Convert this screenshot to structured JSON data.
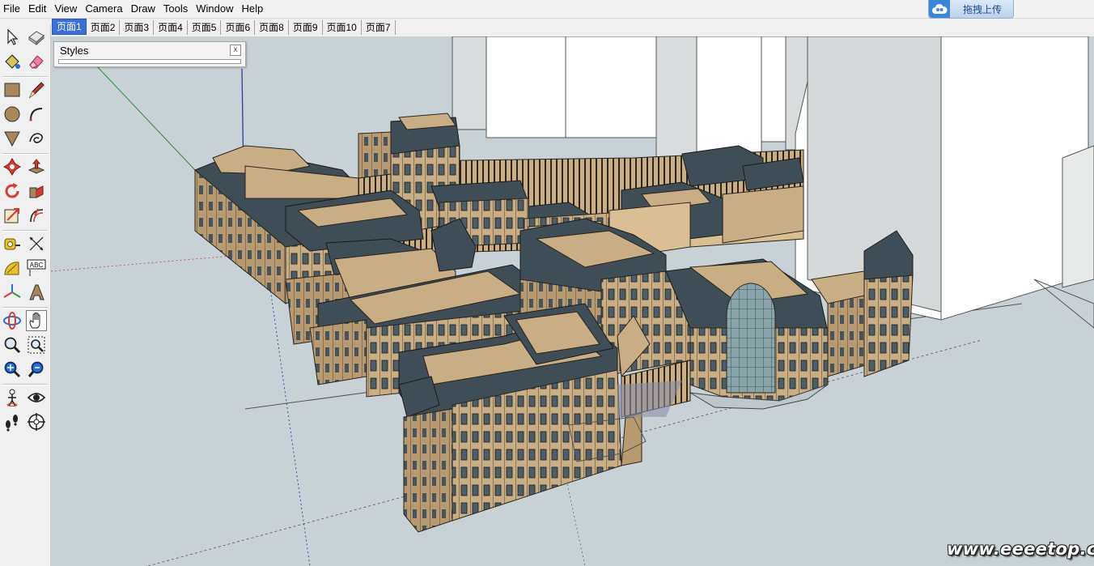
{
  "menu": [
    "File",
    "Edit",
    "View",
    "Camera",
    "Draw",
    "Tools",
    "Window",
    "Help"
  ],
  "upload_button": {
    "label": "拖拽上传",
    "icon": "cloud-upload-icon"
  },
  "scene_tabs": [
    {
      "label": "页面1",
      "active": true
    },
    {
      "label": "页面2"
    },
    {
      "label": "页面3"
    },
    {
      "label": "页面4"
    },
    {
      "label": "页面5"
    },
    {
      "label": "页面6"
    },
    {
      "label": "页面8"
    },
    {
      "label": "页面9"
    },
    {
      "label": "页面10"
    },
    {
      "label": "页面7"
    }
  ],
  "styles_panel": {
    "title": "Styles",
    "close_glyph": "x"
  },
  "tools": [
    "select-icon",
    "make-component-icon",
    "paint-bucket-icon",
    "eraser-icon",
    "rectangle-icon",
    "line-icon",
    "circle-icon",
    "arc-icon",
    "polygon-icon",
    "freehand-icon",
    "move-icon",
    "push-pull-icon",
    "rotate-icon",
    "follow-me-icon",
    "scale-icon",
    "offset-icon",
    "tape-measure-icon",
    "dimension-icon",
    "protractor-icon",
    "text-icon",
    "axes-icon",
    "3d-text-icon",
    "orbit-icon",
    "pan-icon",
    "zoom-icon",
    "zoom-window-icon",
    "zoom-extents-icon",
    "previous-view-icon",
    "position-camera-icon",
    "look-around-icon",
    "walk-icon",
    "section-plane-icon"
  ],
  "text_tool_glyph": "ABC",
  "watermark": "www.eeeetop.com",
  "colors": {
    "viewport_bg": "#c8d2d6",
    "facade": "#c9ad84",
    "roof": "#3f4d57",
    "tower": "#f7f7f7",
    "active_tab": "#3a6fd6"
  }
}
